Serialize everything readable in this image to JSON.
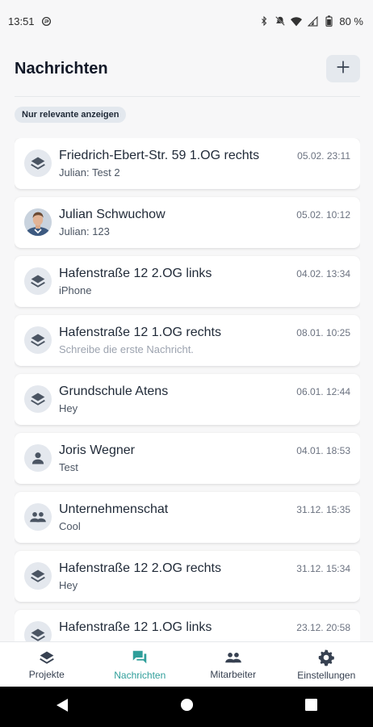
{
  "status_bar": {
    "time": "13:51",
    "battery": "80 %"
  },
  "header": {
    "title": "Nachrichten",
    "add_label": "+"
  },
  "filter": {
    "label": "Nur relevante anzeigen"
  },
  "colors": {
    "accent": "#2f9e9a",
    "avatar_bg": "#e4e8ee",
    "icon": "#4b5563"
  },
  "chats": [
    {
      "title": "Friedrich-Ebert-Str. 59 1.OG rechts",
      "preview": "Julian: Test 2",
      "time": "05.02. 23:11",
      "icon": "layers-icon"
    },
    {
      "title": "Julian Schwuchow",
      "preview": "Julian: 123",
      "time": "05.02. 10:12",
      "icon": "profile-photo"
    },
    {
      "title": "Hafenstraße 12 2.OG links",
      "preview": "iPhone",
      "time": "04.02. 13:34",
      "icon": "layers-icon"
    },
    {
      "title": "Hafenstraße 12 1.OG rechts",
      "preview": "Schreibe die erste Nachricht.",
      "time": "08.01. 10:25",
      "icon": "layers-icon",
      "placeholder": true
    },
    {
      "title": "Grundschule Atens",
      "preview": "Hey",
      "time": "06.01. 12:44",
      "icon": "layers-icon"
    },
    {
      "title": "Joris Wegner",
      "preview": "Test",
      "time": "04.01. 18:53",
      "icon": "person-icon"
    },
    {
      "title": "Unternehmenschat",
      "preview": "Cool",
      "time": "31.12. 15:35",
      "icon": "group-icon"
    },
    {
      "title": "Hafenstraße 12 2.OG rechts",
      "preview": "Hey",
      "time": "31.12. 15:34",
      "icon": "layers-icon"
    },
    {
      "title": "Hafenstraße 12 1.OG links",
      "preview": "",
      "time": "23.12. 20:58",
      "icon": "layers-icon"
    }
  ],
  "bottom_nav": [
    {
      "label": "Projekte",
      "icon": "layers-icon"
    },
    {
      "label": "Nachrichten",
      "icon": "chat-icon",
      "active": true
    },
    {
      "label": "Mitarbeiter",
      "icon": "group-icon"
    },
    {
      "label": "Einstellungen",
      "icon": "gear-icon"
    }
  ]
}
